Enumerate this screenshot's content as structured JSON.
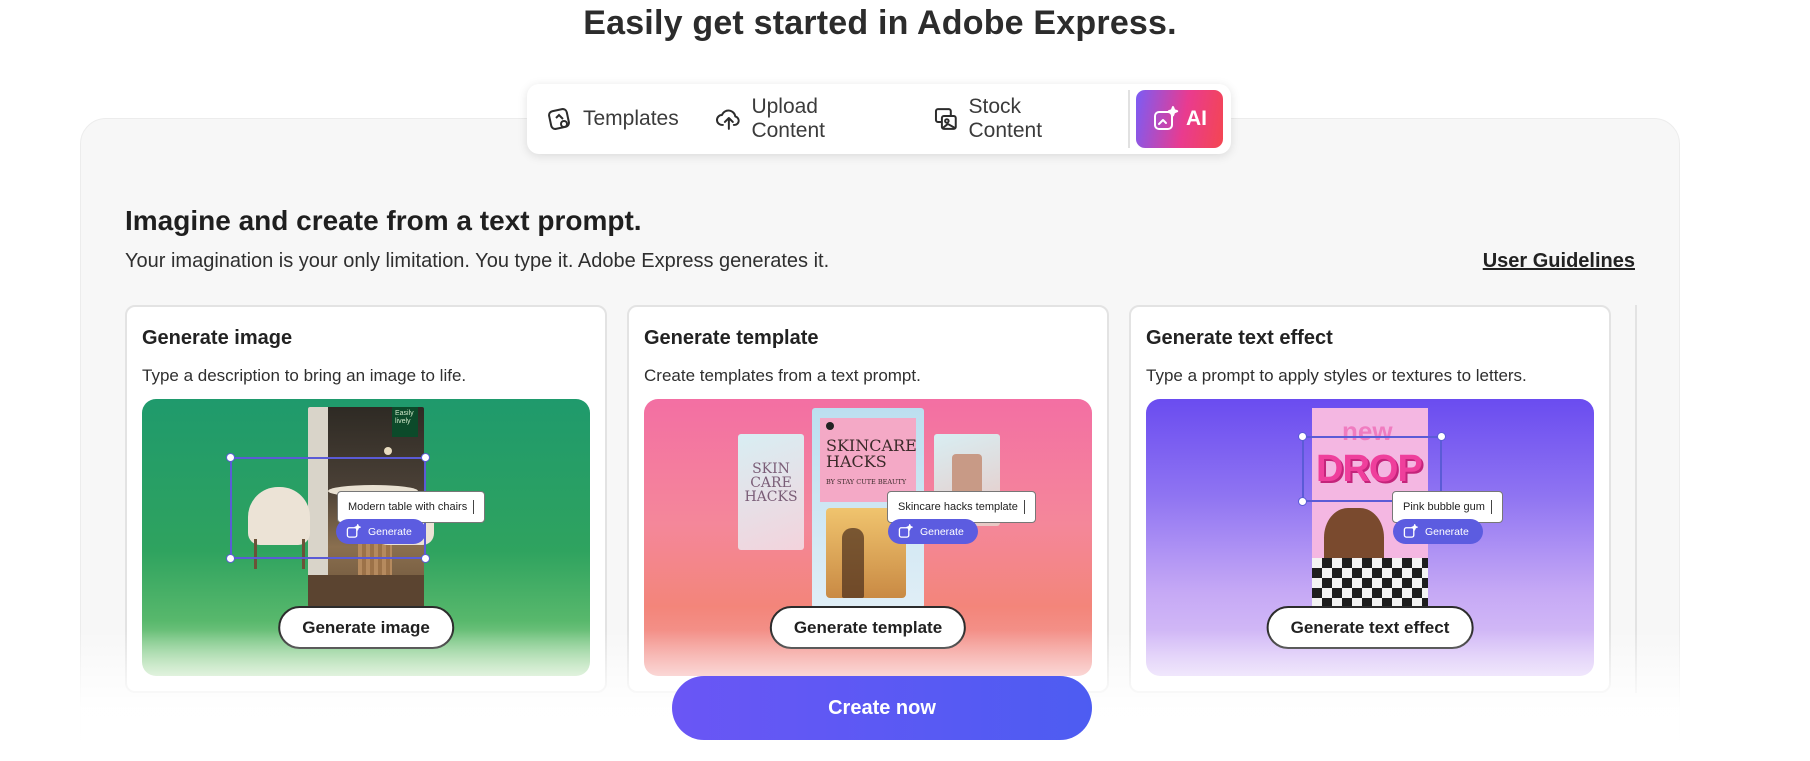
{
  "headline": "Easily get started in Adobe Express.",
  "tabs": [
    {
      "label": "Templates",
      "icon": "templates-icon"
    },
    {
      "label": "Upload Content",
      "icon": "upload-cloud-icon"
    },
    {
      "label": "Stock Content",
      "icon": "stock-content-icon"
    },
    {
      "label": "AI",
      "icon": "ai-sparkle-icon",
      "active": true
    }
  ],
  "section": {
    "title": "Imagine and create from a text prompt.",
    "subtitle": "Your imagination is your only limitation. You type it. Adobe Express generates it.",
    "guidelines_link": "User Guidelines"
  },
  "cards": [
    {
      "title": "Generate image",
      "description": "Type a description to bring an image to life.",
      "prompt": "Modern table with chairs",
      "generate_label": "Generate",
      "button_label": "Generate image",
      "poster_text": "Easily\nlively"
    },
    {
      "title": "Generate template",
      "description": "Create templates from a text prompt.",
      "prompt": "Skincare hacks template",
      "generate_label": "Generate",
      "button_label": "Generate template",
      "poster_title": "SKINCARE\nHACKS",
      "poster_by": "BY STAY CUTE BEAUTY",
      "poster_left": "SKIN\nCARE\nHACKS"
    },
    {
      "title": "Generate text effect",
      "description": "Type a prompt to apply styles or textures to letters.",
      "prompt": "Pink bubble gum",
      "generate_label": "Generate",
      "button_label": "Generate text effect",
      "effect_word": "DROP",
      "effect_word_top": "new"
    }
  ],
  "cta_label": "Create now",
  "colors": {
    "ai_gradient_start": "#7b5cf5",
    "ai_gradient_end": "#f44651",
    "cta": "#5b58f3",
    "generate_pill": "#5c5ce0"
  }
}
